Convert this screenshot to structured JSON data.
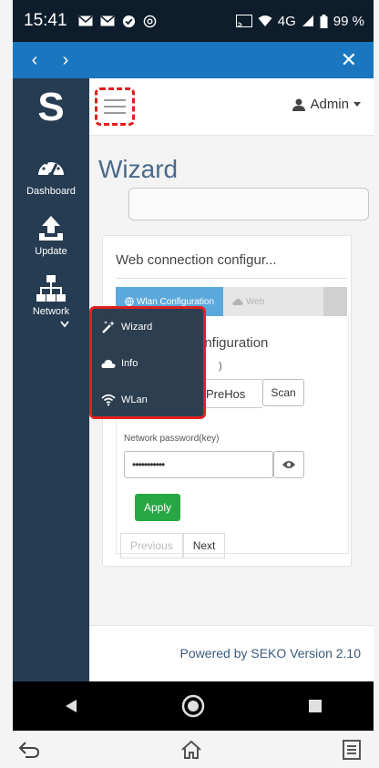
{
  "status": {
    "time": "15:41",
    "network": "4G",
    "battery": "99 %"
  },
  "browser": {
    "back_icon": "chevron-left-icon",
    "forward_icon": "chevron-right-icon",
    "close_icon": "close-icon"
  },
  "sidebar": {
    "logo": "S",
    "items": [
      {
        "label": "Dashboard",
        "icon": "dashboard-gauge-icon"
      },
      {
        "label": "Update",
        "icon": "upload-icon"
      },
      {
        "label": "Network",
        "icon": "sitemap-icon"
      }
    ]
  },
  "header": {
    "user": "Admin",
    "menu_icon": "hamburger-menu-icon"
  },
  "page": {
    "title": "Wizard"
  },
  "card": {
    "heading": "Web connection configur...",
    "tabs": [
      "Wlan Configuration",
      "Web"
    ],
    "section_title_fragment": "onfiguration",
    "field_fragment": ")",
    "ssid_value": "PreHos",
    "scan_label": "Scan",
    "password_label": "Network password(key)",
    "password_value": "•••••••••••",
    "apply_label": "Apply",
    "prev_label": "Previous",
    "next_label": "Next"
  },
  "dropdown": {
    "items": [
      {
        "label": "Wizard",
        "icon": "magic-wand-icon"
      },
      {
        "label": "Info",
        "icon": "cloud-icon"
      },
      {
        "label": "WLan",
        "icon": "wifi-icon"
      }
    ]
  },
  "footer": {
    "text": "Powered by SEKO Version 2.10"
  },
  "colors": {
    "sidebar": "#263c52",
    "browser_bar": "#1976bf",
    "status_bar": "#0e1d2b",
    "accent_tab": "#5ba8dd",
    "apply": "#28a745",
    "highlight": "#e02020"
  }
}
